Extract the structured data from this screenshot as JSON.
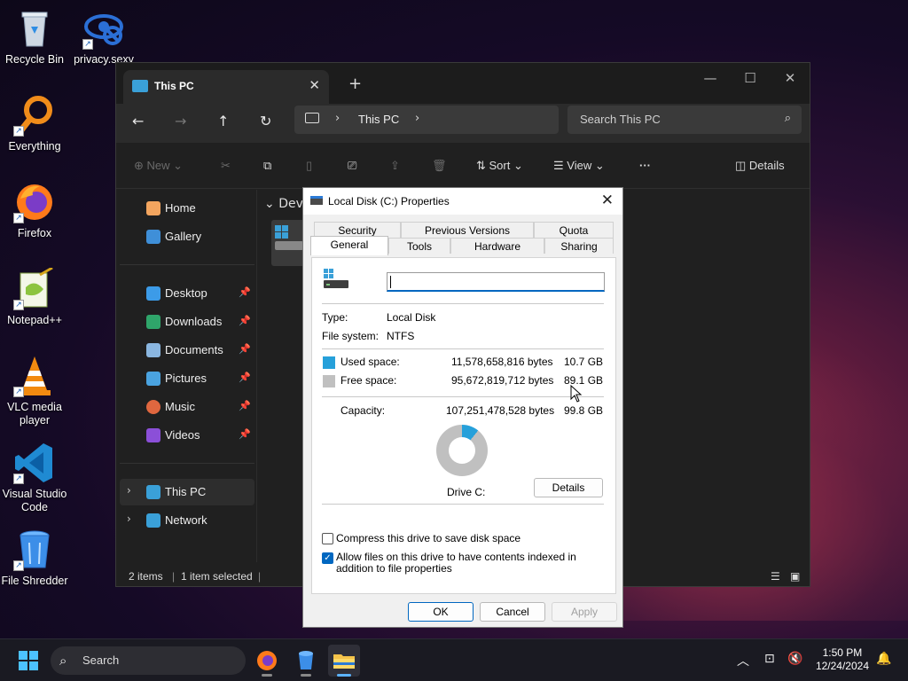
{
  "desktop": {
    "icons": [
      {
        "label": "Recycle Bin"
      },
      {
        "label": "privacy.sexy"
      },
      {
        "label": "Everything"
      },
      {
        "label": "Firefox"
      },
      {
        "label": "Notepad++"
      },
      {
        "label": "VLC media player"
      },
      {
        "label": "Visual Studio Code"
      },
      {
        "label": "File Shredder"
      }
    ]
  },
  "explorer": {
    "tab_title": "This PC",
    "address_path": "This PC",
    "search_placeholder": "Search This PC",
    "toolbar": {
      "new_label": "New",
      "sort_label": "Sort",
      "view_label": "View",
      "more_label": "···",
      "details_label": "Details"
    },
    "sidebar": {
      "items": [
        {
          "label": "Home"
        },
        {
          "label": "Gallery"
        },
        {
          "label": "Desktop"
        },
        {
          "label": "Downloads"
        },
        {
          "label": "Documents"
        },
        {
          "label": "Pictures"
        },
        {
          "label": "Music"
        },
        {
          "label": "Videos"
        },
        {
          "label": "This PC"
        },
        {
          "label": "Network"
        }
      ]
    },
    "content": {
      "section_header": "Devi"
    },
    "status": {
      "items_count": "2 items",
      "selected": "1 item selected"
    }
  },
  "properties": {
    "title": "Local Disk (C:) Properties",
    "tabs_row1": [
      "Security",
      "Previous Versions",
      "Quota"
    ],
    "tabs_row2": [
      "General",
      "Tools",
      "Hardware",
      "Sharing"
    ],
    "name_value": "",
    "type_label": "Type:",
    "type_value": "Local Disk",
    "fs_label": "File system:",
    "fs_value": "NTFS",
    "used_label": "Used space:",
    "used_bytes": "11,578,658,816 bytes",
    "used_size": "10.7 GB",
    "free_label": "Free space:",
    "free_bytes": "95,672,819,712 bytes",
    "free_size": "89.1 GB",
    "capacity_label": "Capacity:",
    "capacity_bytes": "107,251,478,528 bytes",
    "capacity_size": "99.8 GB",
    "drive_label": "Drive C:",
    "details_button": "Details",
    "compress_label": "Compress this drive to save disk space",
    "compress_checked": false,
    "index_label": "Allow files on this drive to have contents indexed in addition to file properties",
    "index_checked": true,
    "ok_label": "OK",
    "cancel_label": "Cancel",
    "apply_label": "Apply",
    "used_fraction": 0.108,
    "colors": {
      "used": "#26a0da",
      "free": "#c0c0c0"
    }
  },
  "taskbar": {
    "search_label": "Search",
    "time": "1:50 PM",
    "date": "12/24/2024"
  }
}
